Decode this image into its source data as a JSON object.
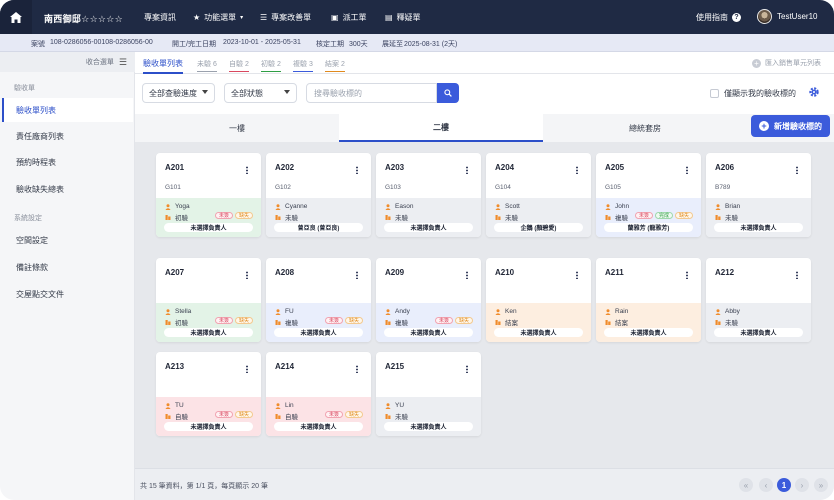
{
  "topnav": {
    "brand": "南西御邸☆☆☆☆☆",
    "items": [
      {
        "label": "專案資訊",
        "icon": ""
      },
      {
        "label": "功能選單",
        "icon": "star-icon"
      },
      {
        "label": "專案改善單",
        "icon": "list-icon"
      },
      {
        "label": "派工單",
        "icon": "clipboard-icon"
      },
      {
        "label": "釋疑單",
        "icon": "chat-icon"
      }
    ],
    "help_label": "使用指南",
    "username": "TestUser10"
  },
  "infobar": {
    "case_label": "案號",
    "case_value": "108-0286056-00108-0286056-00",
    "dates_label": "開工/完工日期",
    "dates_value": "2023-10-01 - 2025-05-31",
    "approved_label": "核定工期",
    "approved_value": "300天",
    "extension_label": "展延至",
    "extension_value": "2025-08-31 (2天)"
  },
  "sidebar": {
    "collapse_label": "收合選單",
    "section1": "驗收單",
    "items1": [
      "驗收單列表",
      "責任廠商列表",
      "預約時程表",
      "驗收缺失總表"
    ],
    "section2": "系統設定",
    "items2": [
      "空間設定",
      "備註條款",
      "交屋點交文件"
    ]
  },
  "tabs": {
    "main": "驗收單列表",
    "sub": [
      {
        "label": "未驗",
        "count": "6",
        "color": "#9aa1ad"
      },
      {
        "label": "自驗",
        "count": "2",
        "color": "#d9485f"
      },
      {
        "label": "初驗",
        "count": "2",
        "color": "#2f9e44"
      },
      {
        "label": "複驗",
        "count": "3",
        "color": "#3b5bdb"
      },
      {
        "label": "結案",
        "count": "2",
        "color": "#e08a1e"
      }
    ],
    "import_label": "匯入銷售單元列表"
  },
  "filters": {
    "progress": "全部查驗進度",
    "status": "全部狀態",
    "search_placeholder": "搜尋驗收標的",
    "only_mine": "僅顯示我的驗收標的"
  },
  "floors": [
    "一樓",
    "二樓",
    "總統套房"
  ],
  "active_floor": "二樓",
  "add_button": "新增驗收標的",
  "units": [
    {
      "name": "A201",
      "code": "G101",
      "person": "Yoga",
      "status": "初驗",
      "badges": [
        "red",
        "orange"
      ],
      "owner": "未選擇負責人",
      "tint": "#e3f3e7"
    },
    {
      "name": "A202",
      "code": "G102",
      "person": "Cyanne",
      "status": "未驗",
      "badges": [],
      "owner": "曾亞良 (曾亞良)",
      "tint": "#eceef2"
    },
    {
      "name": "A203",
      "code": "G103",
      "person": "Eason",
      "status": "未驗",
      "badges": [],
      "owner": "未選擇負責人",
      "tint": "#eceef2"
    },
    {
      "name": "A204",
      "code": "G104",
      "person": "Scott",
      "status": "未驗",
      "badges": [],
      "owner": "企鵝 (顏碧愛)",
      "tint": "#eceef2"
    },
    {
      "name": "A205",
      "code": "G105",
      "person": "John",
      "status": "複驗",
      "badges": [
        "red",
        "green",
        "orange"
      ],
      "owner": "蘭雅芳 (龍雅芳)",
      "tint": "#e9eefc"
    },
    {
      "name": "A206",
      "code": "B789",
      "person": "Brian",
      "status": "未驗",
      "badges": [],
      "owner": "未選擇負責人",
      "tint": "#eceef2"
    },
    {
      "name": "A207",
      "code": "",
      "person": "Stella",
      "status": "初驗",
      "badges": [
        "red",
        "orange"
      ],
      "owner": "未選擇負責人",
      "tint": "#e3f3e7"
    },
    {
      "name": "A208",
      "code": "",
      "person": "FU",
      "status": "複驗",
      "badges": [
        "red",
        "orange"
      ],
      "owner": "未選擇負責人",
      "tint": "#e9eefc"
    },
    {
      "name": "A209",
      "code": "",
      "person": "Andy",
      "status": "複驗",
      "badges": [
        "red",
        "orange"
      ],
      "owner": "未選擇負責人",
      "tint": "#e9eefc"
    },
    {
      "name": "A210",
      "code": "",
      "person": "Ken",
      "status": "結案",
      "badges": [],
      "owner": "未選擇負責人",
      "tint": "#fdeee0"
    },
    {
      "name": "A211",
      "code": "",
      "person": "Rain",
      "status": "結案",
      "badges": [],
      "owner": "未選擇負責人",
      "tint": "#fdeee0"
    },
    {
      "name": "A212",
      "code": "",
      "person": "Abby",
      "status": "未驗",
      "badges": [],
      "owner": "未選擇負責人",
      "tint": "#eceef2"
    },
    {
      "name": "A213",
      "code": "",
      "person": "TU",
      "status": "自驗",
      "badges": [
        "red",
        "orange"
      ],
      "owner": "未選擇負責人",
      "tint": "#fce3e6"
    },
    {
      "name": "A214",
      "code": "",
      "person": "Lin",
      "status": "自驗",
      "badges": [
        "red",
        "orange"
      ],
      "owner": "未選擇負責人",
      "tint": "#fce3e6"
    },
    {
      "name": "A215",
      "code": "",
      "person": "YU",
      "status": "未驗",
      "badges": [],
      "owner": "未選擇負責人",
      "tint": "#eceef2"
    }
  ],
  "badge_labels": {
    "red": "未簽",
    "orange": "缺失",
    "green": "完成"
  },
  "footer": {
    "summary": "共 15 筆資料，第 1/1 頁，每頁顯示 20 筆",
    "pages": [
      "«",
      "‹",
      "1",
      "›",
      "»"
    ],
    "current_page": "1"
  },
  "colors": {
    "accent": "#3b5bdb",
    "nav": "#1f2a44"
  }
}
